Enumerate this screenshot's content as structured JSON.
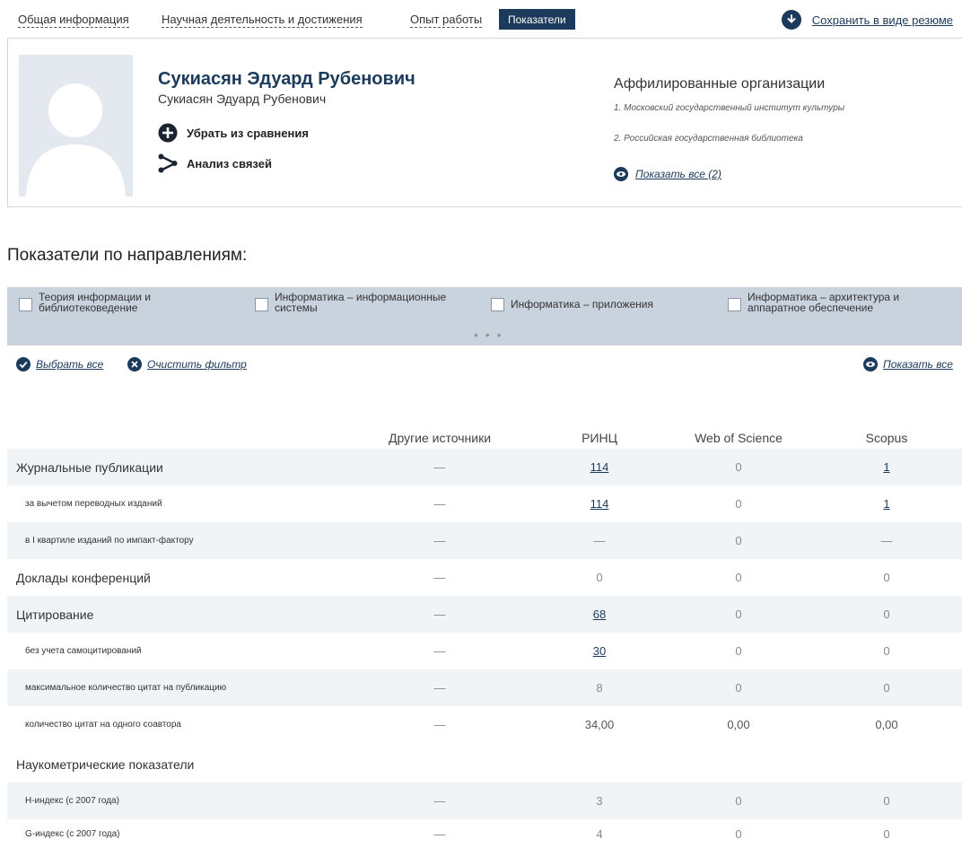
{
  "nav": {
    "tabs": [
      "Общая информация",
      "Научная деятельность и достижения",
      "Опыт работы",
      "Показатели"
    ],
    "active_tab": "Показатели",
    "save_label": "Сохранить в виде резюме"
  },
  "profile": {
    "name": "Сукиасян Эдуард Рубенович",
    "subname": "Сукиасян Эдуард Рубенович",
    "actions": [
      "Убрать из сравнения",
      "Анализ связей"
    ]
  },
  "affiliations": {
    "title": "Аффилированные организации",
    "items": [
      "1. Московский государственный институт культуры",
      "2. Российская государственная библиотека"
    ],
    "show_all": "Показать все (2)"
  },
  "section_title": "Показатели по направлениям:",
  "filters": {
    "items": [
      "Теория информации и библиотековедение",
      "Информатика – информационные системы",
      "Информатика – приложения",
      "Информатика – архитектура и аппаратное обеспечение"
    ],
    "more": "• • •",
    "select_all": "Выбрать все",
    "clear": "Очистить фильтр",
    "show_all": "Показать все"
  },
  "table": {
    "columns": [
      "Другие источники",
      "РИНЦ",
      "Web of Science",
      "Scopus"
    ],
    "rows": [
      {
        "label": "Журнальные публикации",
        "level": "main",
        "values": [
          "—",
          "114",
          "0",
          "1"
        ]
      },
      {
        "label": "за вычетом переводных изданий",
        "level": "sub",
        "values": [
          "—",
          "114",
          "0",
          "1"
        ]
      },
      {
        "label": "в I квартиле изданий по импакт-фактору",
        "level": "sub",
        "values": [
          "—",
          "—",
          "0",
          "—"
        ]
      },
      {
        "label": "Доклады конференций",
        "level": "main",
        "values": [
          "—",
          "0",
          "0",
          "0"
        ]
      },
      {
        "label": "Цитирование",
        "level": "main",
        "values": [
          "—",
          "68",
          "0",
          "0"
        ]
      },
      {
        "label": "без учета самоцитирований",
        "level": "sub",
        "values": [
          "—",
          "30",
          "0",
          "0"
        ]
      },
      {
        "label": "максимальное количество цитат на публикацию",
        "level": "sub",
        "values": [
          "—",
          "8",
          "0",
          "0"
        ]
      },
      {
        "label": "количество цитат на одного соавтора",
        "level": "sub",
        "values": [
          "—",
          "34,00",
          "0,00",
          "0,00"
        ]
      },
      {
        "label": "Наукометрические показатели",
        "level": "main",
        "values": [
          "",
          "",
          "",
          ""
        ]
      },
      {
        "label": "H-индекс (с 2007 года)",
        "level": "sub",
        "values": [
          "—",
          "3",
          "0",
          "0"
        ]
      },
      {
        "label": "G-индекс (с 2007 года)",
        "level": "sub",
        "values": [
          "—",
          "4",
          "0",
          "0"
        ]
      }
    ]
  },
  "colors": {
    "accent": "#1b3a5c",
    "filter_bg": "#c9d3de",
    "row_shade": "#f1f4f7"
  }
}
